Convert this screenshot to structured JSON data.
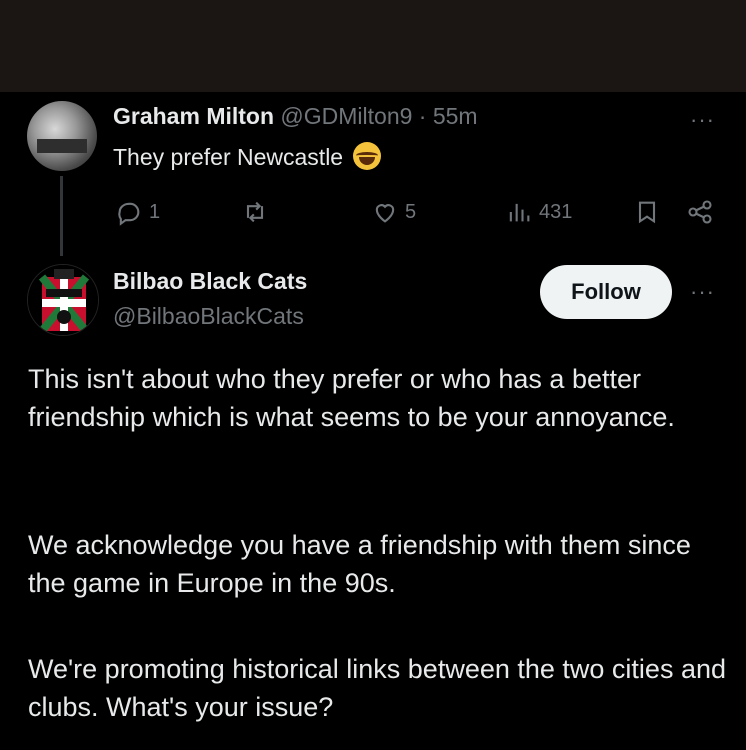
{
  "reply_tweet": {
    "author_name": "Graham Milton",
    "author_meta": "@GDMilton9 · 55m",
    "text": "They prefer Newcastle",
    "emoji": "face-with-tears-of-joy",
    "actions": {
      "replies": "1",
      "likes": "5",
      "views": "431"
    }
  },
  "main_tweet": {
    "author_name": "Bilbao Black Cats",
    "author_handle": "@BilbaoBlackCats",
    "follow_label": "Follow",
    "paragraphs": [
      "This isn't about who they prefer or who has a better friendship which is what seems to be your annoyance.",
      "We acknowledge you have a friendship with them since the game in Europe in the 90s.",
      "We're promoting historical links between the two cities and clubs. What's your issue?"
    ]
  },
  "more_label": "···",
  "colors": {
    "background": "#000000",
    "topbar": "#1b1613",
    "text_primary": "#e7e9ea",
    "text_secondary": "#71767b",
    "follow_bg": "#eff3f4"
  }
}
